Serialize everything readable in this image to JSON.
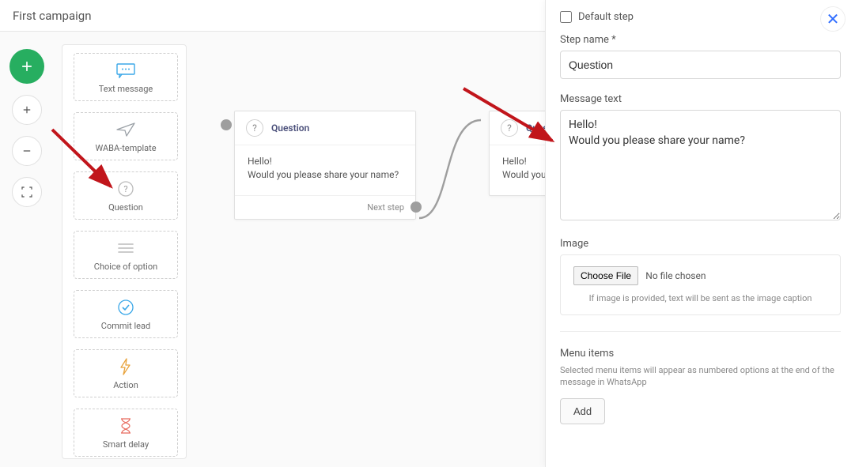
{
  "header": {
    "title": "First campaign"
  },
  "palette": {
    "items": [
      {
        "id": "text-message",
        "label": "Text message",
        "icon": "message"
      },
      {
        "id": "waba-template",
        "label": "WABA-template",
        "icon": "plane"
      },
      {
        "id": "question",
        "label": "Question",
        "icon": "question"
      },
      {
        "id": "choice-of-option",
        "label": "Choice of option",
        "icon": "list"
      },
      {
        "id": "commit-lead",
        "label": "Commit lead",
        "icon": "check"
      },
      {
        "id": "action",
        "label": "Action",
        "icon": "bolt"
      },
      {
        "id": "smart-delay",
        "label": "Smart delay",
        "icon": "hourglass"
      }
    ]
  },
  "nodes": {
    "n1": {
      "title": "Question",
      "body_line1": "Hello!",
      "body_line2": "Would you please share your name?",
      "next_label": "Next step"
    },
    "n2": {
      "title": "Ques",
      "body_line1": "Hello!",
      "body_line2": "Would you"
    }
  },
  "panel": {
    "default_step_label": "Default step",
    "step_name_label": "Step name *",
    "step_name_value": "Question",
    "message_text_label": "Message text",
    "message_text_value": "Hello!\nWould you please share your name?",
    "image_label": "Image",
    "choose_file_label": "Choose File",
    "no_file_chosen": "No file chosen",
    "image_caption_note": "If image is provided, text will be sent as the image caption",
    "menu_items_label": "Menu items",
    "menu_items_note": "Selected menu items will appear as numbered options at the end of the message in WhatsApp",
    "add_button": "Add"
  }
}
